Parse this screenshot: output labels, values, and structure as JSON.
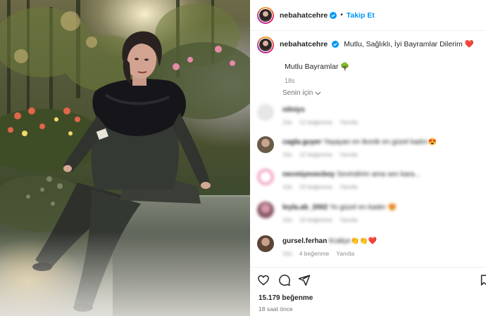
{
  "header": {
    "username": "nebahatcehre",
    "follow_label": "Takip Et",
    "separator": "•"
  },
  "caption": {
    "username": "nebahatcehre",
    "text": "Mutlu, Sağlıklı, İyi Bayramlar Dilerim",
    "emoji": "❤️",
    "subtext": "Mutlu Bayramlar",
    "subtext_emoji": "🌳",
    "time": "18s"
  },
  "sort": {
    "label": "Senin için"
  },
  "comments": [
    {
      "username": "nilniys",
      "text": "",
      "time": "10s",
      "likes": "12 beğenme",
      "reply": "Yanıtla",
      "avatar_color": "#e6e6e6"
    },
    {
      "username": "cagla.guyer",
      "text": "Yaşayan en ikonik en güzel kadın",
      "emoji": "😍",
      "time": "10s",
      "likes": "12 beğenme",
      "reply": "Yanıtla",
      "avatar_color": "#8a7a6a"
    },
    {
      "username": "necmiyevecboy",
      "text": "Sevindirim ama sen kara...",
      "time": "10s",
      "likes": "10 beğenme",
      "reply": "Yanıtla",
      "avatar_color": "#f3a8c8"
    },
    {
      "username": "leyla.ab_2002",
      "text": "Yo güzel en kader",
      "emoji": "😍",
      "time": "10s",
      "likes": "10 beğenme",
      "reply": "Yanıtla",
      "avatar_color": "#b07a8e"
    },
    {
      "username": "gursel.ferhan",
      "text": "Kraliçe",
      "emoji": "👏👏❤️",
      "time": "10s",
      "likes": "4 beğenme",
      "reply": "Yanıtla",
      "avatar_color": "#8a6a5a"
    }
  ],
  "footer": {
    "likes": "15.179 beğenme",
    "time": "18 saat önce"
  },
  "colors": {
    "accent": "#0095f6",
    "text": "#262626",
    "muted": "#8e8e8e",
    "heart": "#ed4956"
  }
}
